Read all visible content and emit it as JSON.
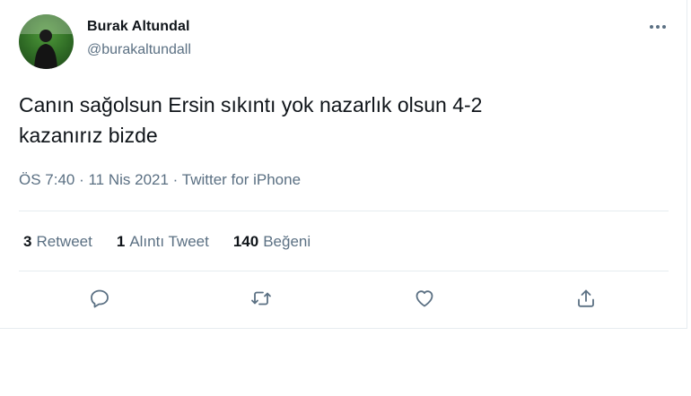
{
  "user": {
    "display_name": "Burak Altundal",
    "username": "@burakaltundall",
    "avatar_icon": "profile-photo"
  },
  "tweet": {
    "text": "Canın sağolsun Ersin sıkıntı yok nazarlık olsun 4-2\nkazanırız bizde",
    "time": "ÖS 7:40",
    "date": "11 Nis 2021",
    "source": "Twitter for iPhone",
    "separator": " · "
  },
  "stats": {
    "retweets": {
      "count": "3",
      "label": "Retweet"
    },
    "quotes": {
      "count": "1",
      "label": "Alıntı Tweet"
    },
    "likes": {
      "count": "140",
      "label": "Beğeni"
    }
  },
  "actions": [
    {
      "icon": "reply-icon"
    },
    {
      "icon": "retweet-icon"
    },
    {
      "icon": "like-icon"
    },
    {
      "icon": "share-icon"
    }
  ],
  "more_icon": "more-options-icon",
  "colors": {
    "text_primary": "#0f1419",
    "text_secondary": "#5b7083",
    "divider": "#e6ecf0"
  }
}
